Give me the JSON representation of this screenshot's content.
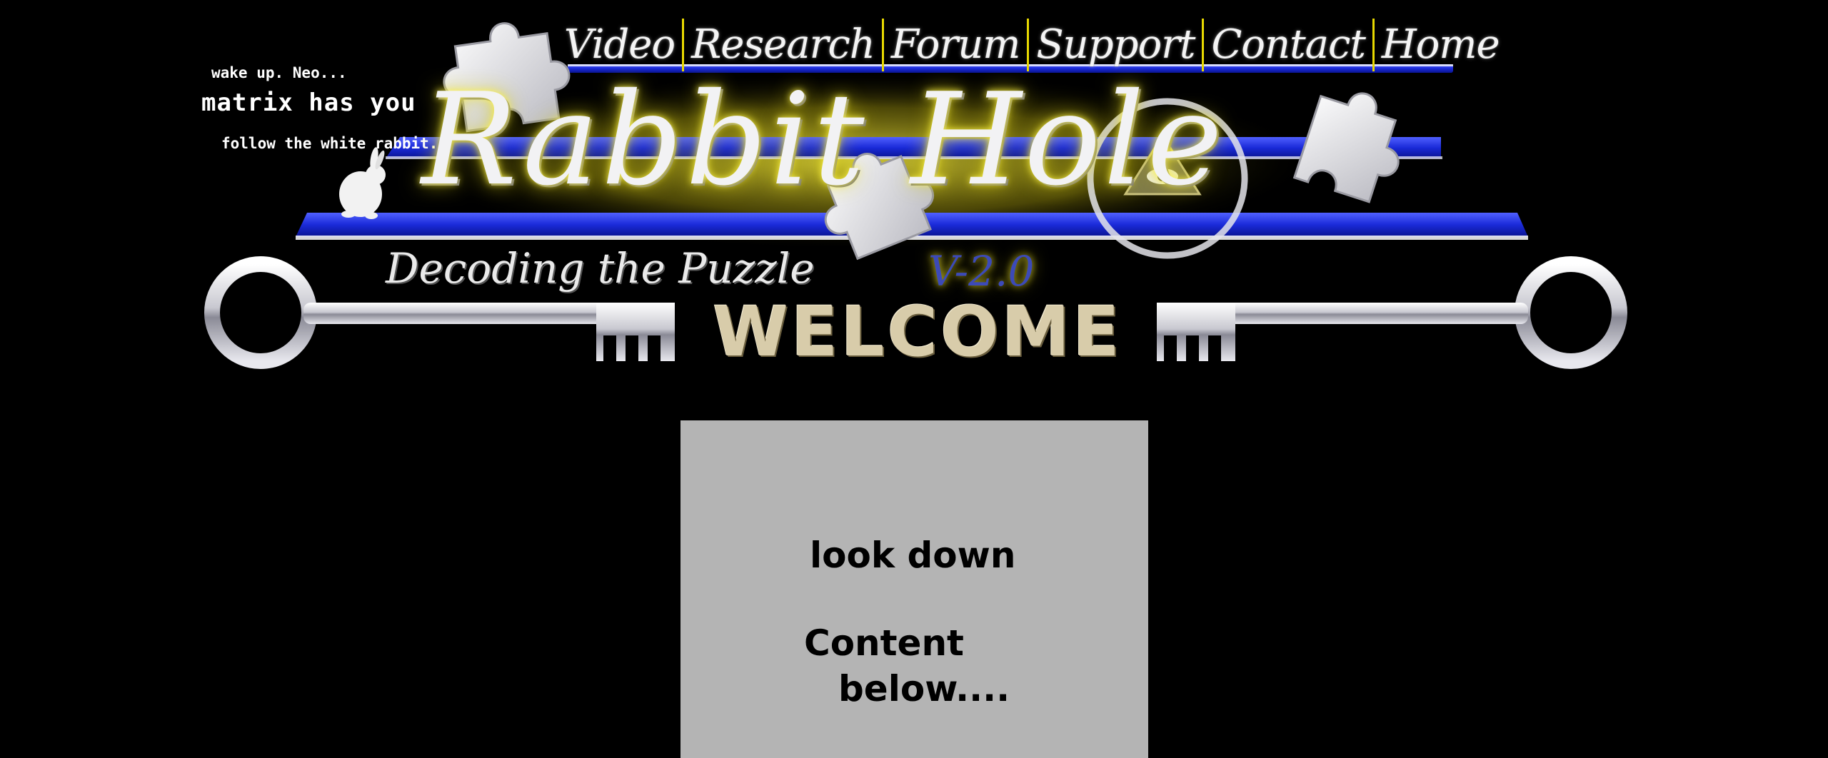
{
  "tagline": {
    "line1": "wake up. Neo...",
    "line2": "matrix has you",
    "line3": "follow the white rabbit."
  },
  "nav": {
    "items": [
      {
        "label": "Video"
      },
      {
        "label": "Research"
      },
      {
        "label": "Forum"
      },
      {
        "label": "Support"
      },
      {
        "label": "Contact"
      },
      {
        "label": "Home"
      }
    ]
  },
  "header": {
    "title": "Rabbit Hole",
    "subtitle": "Decoding the Puzzle",
    "version": "V-2.0",
    "welcome": "WELCOME"
  },
  "content_box": {
    "line1": "look down",
    "line2": "Content",
    "line3": "below...."
  },
  "colors": {
    "background": "#000000",
    "stripe_blue": "#2233dd",
    "separator_yellow": "#e7d800",
    "glow_yellow": "#e6dc28",
    "box_gray": "#b4b4b4"
  },
  "icons": [
    "puzzle-piece-icon",
    "rabbit-icon",
    "eye-pyramid-icon",
    "key-icon"
  ]
}
